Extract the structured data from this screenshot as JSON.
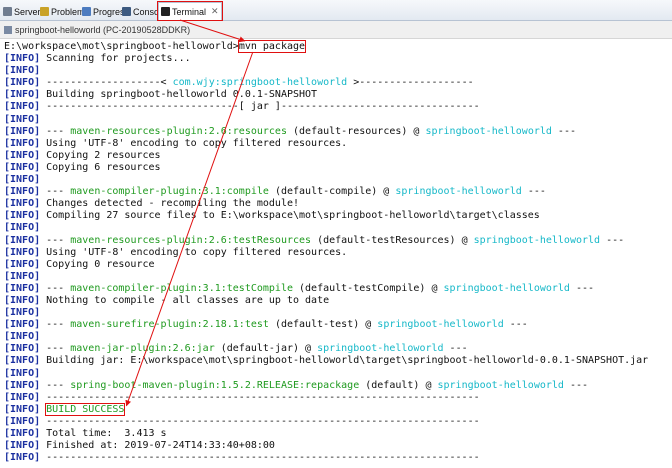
{
  "tabs": [
    {
      "label": "Servers",
      "icon": "server-icon",
      "color": "#6f7c8f"
    },
    {
      "label": "Problems",
      "icon": "problems-icon",
      "color": "#c9a227"
    },
    {
      "label": "Progress",
      "icon": "progress-icon",
      "color": "#4c7bbf"
    },
    {
      "label": "Console",
      "icon": "console-icon",
      "color": "#3d5a80"
    },
    {
      "label": "Terminal",
      "icon": "terminal-icon",
      "color": "#222222"
    }
  ],
  "terminal_title": "springboot-helloworld (PC-20190528DDKR)",
  "prompt": {
    "path": "E:\\workspace\\mot\\springboot-helloworld>",
    "command": "mvn package"
  },
  "lines": [
    [
      {
        "t": "[INFO]",
        "c": "lvl"
      },
      {
        "t": " Scanning for projects..."
      }
    ],
    [
      {
        "t": "[INFO]",
        "c": "lvl"
      }
    ],
    [
      {
        "t": "[INFO]",
        "c": "lvl"
      },
      {
        "t": " -------------------< "
      },
      {
        "t": "com.wjy:springboot-helloworld",
        "c": "cyan"
      },
      {
        "t": " >-------------------"
      }
    ],
    [
      {
        "t": "[INFO]",
        "c": "lvl"
      },
      {
        "t": " Building springboot-helloworld 0.0.1-SNAPSHOT"
      }
    ],
    [
      {
        "t": "[INFO]",
        "c": "lvl"
      },
      {
        "t": " --------------------------------[ jar ]---------------------------------"
      }
    ],
    [
      {
        "t": "[INFO]",
        "c": "lvl"
      }
    ],
    [
      {
        "t": "[INFO]",
        "c": "lvl"
      },
      {
        "t": " --- "
      },
      {
        "t": "maven-resources-plugin:2.6:resources",
        "c": "green"
      },
      {
        "t": " (default-resources) @ "
      },
      {
        "t": "springboot-helloworld",
        "c": "cyan"
      },
      {
        "t": " ---"
      }
    ],
    [
      {
        "t": "[INFO]",
        "c": "lvl"
      },
      {
        "t": " Using 'UTF-8' encoding to copy filtered resources."
      }
    ],
    [
      {
        "t": "[INFO]",
        "c": "lvl"
      },
      {
        "t": " Copying 2 resources"
      }
    ],
    [
      {
        "t": "[INFO]",
        "c": "lvl"
      },
      {
        "t": " Copying 6 resources"
      }
    ],
    [
      {
        "t": "[INFO]",
        "c": "lvl"
      }
    ],
    [
      {
        "t": "[INFO]",
        "c": "lvl"
      },
      {
        "t": " --- "
      },
      {
        "t": "maven-compiler-plugin:3.1:compile",
        "c": "green"
      },
      {
        "t": " (default-compile) @ "
      },
      {
        "t": "springboot-helloworld",
        "c": "cyan"
      },
      {
        "t": " ---"
      }
    ],
    [
      {
        "t": "[INFO]",
        "c": "lvl"
      },
      {
        "t": " Changes detected - recompiling the module!"
      }
    ],
    [
      {
        "t": "[INFO]",
        "c": "lvl"
      },
      {
        "t": " Compiling 27 source files to E:\\workspace\\mot\\springboot-helloworld\\target\\classes"
      }
    ],
    [
      {
        "t": "[INFO]",
        "c": "lvl"
      }
    ],
    [
      {
        "t": "[INFO]",
        "c": "lvl"
      },
      {
        "t": " --- "
      },
      {
        "t": "maven-resources-plugin:2.6:testResources",
        "c": "green"
      },
      {
        "t": " (default-testResources) @ "
      },
      {
        "t": "springboot-helloworld",
        "c": "cyan"
      },
      {
        "t": " ---"
      }
    ],
    [
      {
        "t": "[INFO]",
        "c": "lvl"
      },
      {
        "t": " Using 'UTF-8' encoding to copy filtered resources."
      }
    ],
    [
      {
        "t": "[INFO]",
        "c": "lvl"
      },
      {
        "t": " Copying 0 resource"
      }
    ],
    [
      {
        "t": "[INFO]",
        "c": "lvl"
      }
    ],
    [
      {
        "t": "[INFO]",
        "c": "lvl"
      },
      {
        "t": " --- "
      },
      {
        "t": "maven-compiler-plugin:3.1:testCompile",
        "c": "green"
      },
      {
        "t": " (default-testCompile) @ "
      },
      {
        "t": "springboot-helloworld",
        "c": "cyan"
      },
      {
        "t": " ---"
      }
    ],
    [
      {
        "t": "[INFO]",
        "c": "lvl"
      },
      {
        "t": " Nothing to compile - all classes are up to date"
      }
    ],
    [
      {
        "t": "[INFO]",
        "c": "lvl"
      }
    ],
    [
      {
        "t": "[INFO]",
        "c": "lvl"
      },
      {
        "t": " --- "
      },
      {
        "t": "maven-surefire-plugin:2.18.1:test",
        "c": "green"
      },
      {
        "t": " (default-test) @ "
      },
      {
        "t": "springboot-helloworld",
        "c": "cyan"
      },
      {
        "t": " ---"
      }
    ],
    [
      {
        "t": "[INFO]",
        "c": "lvl"
      }
    ],
    [
      {
        "t": "[INFO]",
        "c": "lvl"
      },
      {
        "t": " --- "
      },
      {
        "t": "maven-jar-plugin:2.6:jar",
        "c": "green"
      },
      {
        "t": " (default-jar) @ "
      },
      {
        "t": "springboot-helloworld",
        "c": "cyan"
      },
      {
        "t": " ---"
      }
    ],
    [
      {
        "t": "[INFO]",
        "c": "lvl"
      },
      {
        "t": " Building jar: E:\\workspace\\mot\\springboot-helloworld\\target\\springboot-helloworld-0.0.1-SNAPSHOT.jar"
      }
    ],
    [
      {
        "t": "[INFO]",
        "c": "lvl"
      }
    ],
    [
      {
        "t": "[INFO]",
        "c": "lvl"
      },
      {
        "t": " --- "
      },
      {
        "t": "spring-boot-maven-plugin:1.5.2.RELEASE:repackage",
        "c": "green"
      },
      {
        "t": " (default) @ "
      },
      {
        "t": "springboot-helloworld",
        "c": "cyan"
      },
      {
        "t": " ---"
      }
    ],
    [
      {
        "t": "[INFO]",
        "c": "lvl"
      },
      {
        "t": " ------------------------------------------------------------------------"
      }
    ],
    [
      {
        "t": "[INFO]",
        "c": "lvl"
      },
      {
        "t": " "
      },
      {
        "t": "BUILD SUCCESS",
        "c": "green boxed"
      }
    ],
    [
      {
        "t": "[INFO]",
        "c": "lvl"
      },
      {
        "t": " ------------------------------------------------------------------------"
      }
    ],
    [
      {
        "t": "[INFO]",
        "c": "lvl"
      },
      {
        "t": " Total time:  3.413 s"
      }
    ],
    [
      {
        "t": "[INFO]",
        "c": "lvl"
      },
      {
        "t": " Finished at: 2019-07-24T14:33:40+08:00"
      }
    ],
    [
      {
        "t": "[INFO]",
        "c": "lvl"
      },
      {
        "t": " ------------------------------------------------------------------------"
      }
    ]
  ],
  "annotation_color": "#e01010"
}
